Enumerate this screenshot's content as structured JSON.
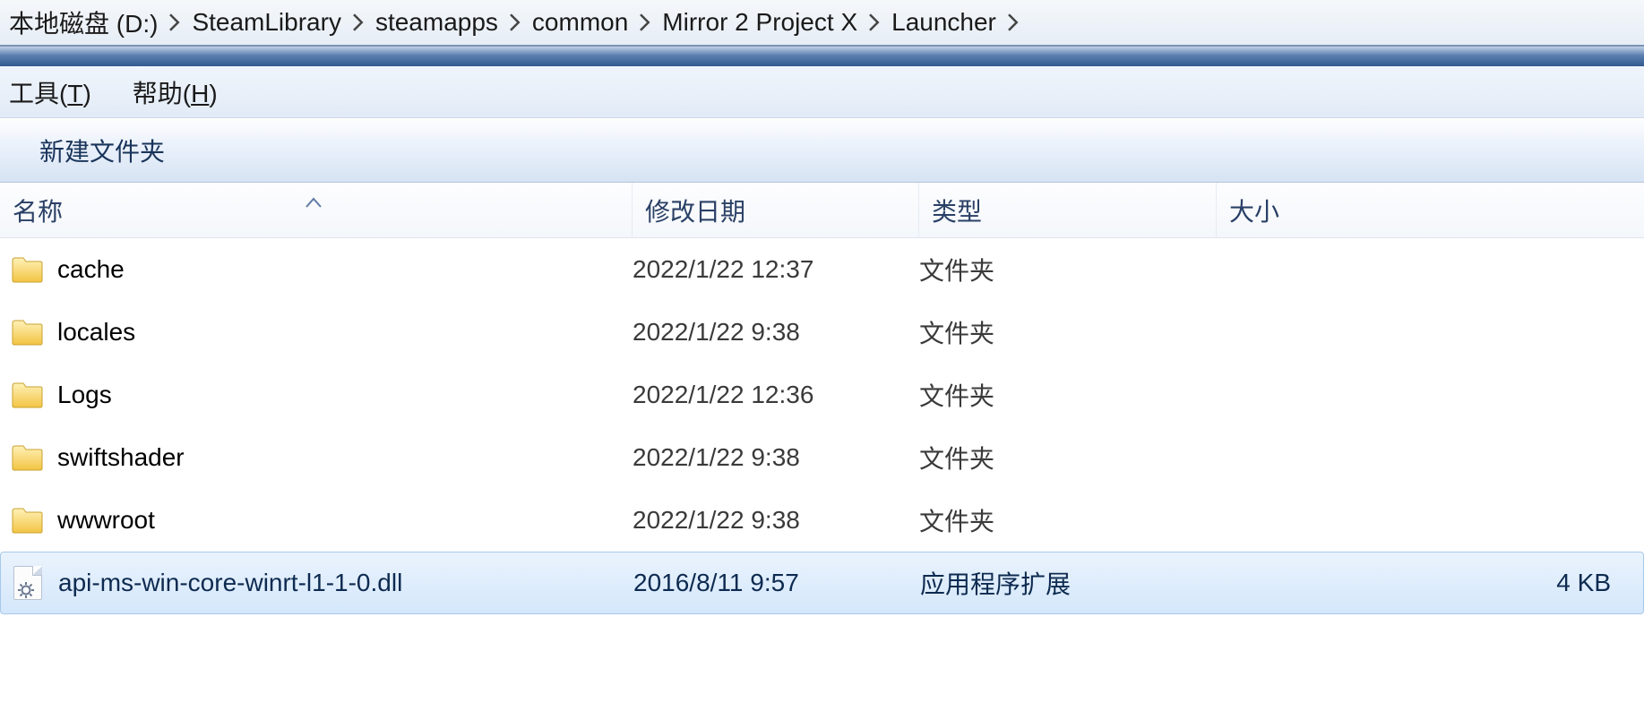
{
  "breadcrumb": {
    "items": [
      "本地磁盘 (D:)",
      "SteamLibrary",
      "steamapps",
      "common",
      "Mirror 2 Project X",
      "Launcher"
    ]
  },
  "menu": {
    "tools": {
      "label": "工具(",
      "accel": "T",
      "suffix": ")"
    },
    "help": {
      "label": "帮助(",
      "accel": "H",
      "suffix": ")"
    }
  },
  "toolbar": {
    "new_folder": "新建文件夹"
  },
  "columns": {
    "name": "名称",
    "date": "修改日期",
    "type": "类型",
    "size": "大小"
  },
  "rows": [
    {
      "icon": "folder",
      "name": "cache",
      "date": "2022/1/22 12:37",
      "type": "文件夹",
      "size": "",
      "selected": false
    },
    {
      "icon": "folder",
      "name": "locales",
      "date": "2022/1/22 9:38",
      "type": "文件夹",
      "size": "",
      "selected": false
    },
    {
      "icon": "folder",
      "name": "Logs",
      "date": "2022/1/22 12:36",
      "type": "文件夹",
      "size": "",
      "selected": false
    },
    {
      "icon": "folder",
      "name": "swiftshader",
      "date": "2022/1/22 9:38",
      "type": "文件夹",
      "size": "",
      "selected": false
    },
    {
      "icon": "folder",
      "name": "wwwroot",
      "date": "2022/1/22 9:38",
      "type": "文件夹",
      "size": "",
      "selected": false
    },
    {
      "icon": "dll",
      "name": "api-ms-win-core-winrt-l1-1-0.dll",
      "date": "2016/8/11 9:57",
      "type": "应用程序扩展",
      "size": "4 KB",
      "selected": true
    }
  ]
}
